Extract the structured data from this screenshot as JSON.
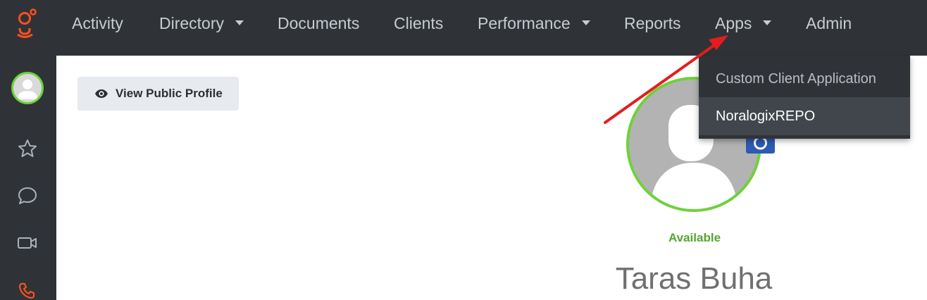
{
  "nav": {
    "items": [
      {
        "label": "Activity"
      },
      {
        "label": "Directory"
      },
      {
        "label": "Documents"
      },
      {
        "label": "Clients"
      },
      {
        "label": "Performance"
      },
      {
        "label": "Reports"
      },
      {
        "label": "Apps"
      },
      {
        "label": "Admin"
      }
    ]
  },
  "apps_menu": {
    "items": [
      {
        "label": "Custom Client Application"
      },
      {
        "label": "NoralogixREPO"
      }
    ]
  },
  "profile": {
    "view_button_label": "View Public Profile",
    "status": "Available",
    "name": "Taras Buha"
  },
  "icons": {
    "logo": "genesys-logo",
    "sidebar": [
      "star-icon",
      "chat-icon",
      "video-icon",
      "phone-icon"
    ],
    "view_button": "eye-icon",
    "photo_badge": "camera-icon"
  },
  "colors": {
    "nav_background": "#2f3338",
    "accent_orange": "#ff4f1f",
    "status_green": "#55a52d",
    "avatar_ring": "#6fd13a",
    "annotation_red": "#e31d1d"
  }
}
